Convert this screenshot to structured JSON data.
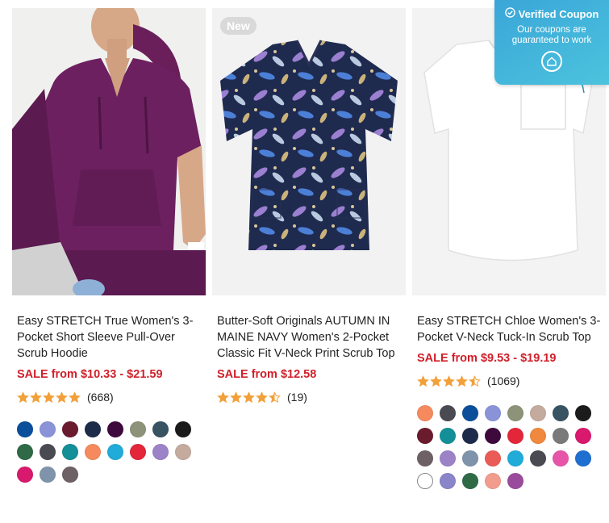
{
  "products": [
    {
      "title": "Easy STRETCH True Women's 3-Pocket Short Sleeve Pull-Over Scrub Hoodie",
      "price": "SALE from $10.33 - $21.59",
      "rating": 5,
      "rating_count": "(668)",
      "swatches": [
        "#0b4f9b",
        "#8a93d8",
        "#6a1b2e",
        "#1d2b4a",
        "#3e0a3d",
        "#8c9379",
        "#385361",
        "#1b1b1b",
        "#2f6a46",
        "#4a4a52",
        "#138f98",
        "#f58a5f",
        "#20abd9",
        "#e3263a",
        "#9c82c7",
        "#c5aa9e",
        "#d8196d",
        "#7f94aa",
        "#6e6166"
      ]
    },
    {
      "badge": "New",
      "title": "Butter-Soft Originals AUTUMN IN MAINE NAVY Women's 2-Pocket Classic Fit V-Neck Print Scrub Top",
      "price": "SALE from $12.58",
      "rating": 4.5,
      "rating_count": "(19)",
      "swatches": []
    },
    {
      "title": "Easy STRETCH Chloe Women's 3-Pocket V-Neck Tuck-In Scrub Top",
      "price": "SALE from $9.53 - $19.19",
      "rating": 4.5,
      "rating_count": "(1069)",
      "swatches": [
        "#f58a5f",
        "#4a4a52",
        "#0b4f9b",
        "#8a93d8",
        "#8c9379",
        "#c5aa9e",
        "#385361",
        "#1b1b1b",
        "#6a1b2e",
        "#138f98",
        "#1d2b4a",
        "#3e0a3d",
        "#e3263a",
        "#f0883d",
        "#7a7a7a",
        "#d8196d",
        "#6e6166",
        "#9c82c7",
        "#7f94aa",
        "#ea5b57",
        "#20abd9",
        "#4a4a52",
        "#e655a8",
        "#1f6fd1",
        "#ffffff",
        "#8a84c9",
        "#2f6a46",
        "#f29c8e",
        "#9b4b9c"
      ]
    }
  ],
  "coupon": {
    "title": "Verified Coupon",
    "subtitle": "Our coupons are guaranteed to work"
  },
  "colors": {
    "accent": "#d0202a",
    "star": "#f2a03a",
    "coupon": "#3aa6d8"
  }
}
